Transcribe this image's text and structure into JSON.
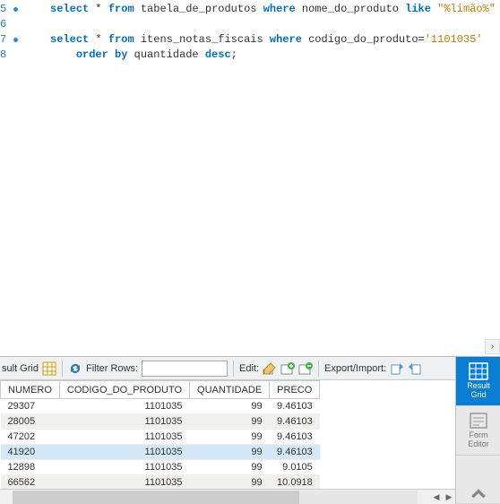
{
  "editor": {
    "lines": [
      {
        "num": "5",
        "dot": true,
        "indent": 1,
        "tokens": [
          {
            "t": "select",
            "c": "kw"
          },
          {
            "t": " * ",
            "c": "id"
          },
          {
            "t": "from",
            "c": "kw"
          },
          {
            "t": " tabela_de_produtos ",
            "c": "id"
          },
          {
            "t": "where",
            "c": "kw"
          },
          {
            "t": " nome_do_produto ",
            "c": "id"
          },
          {
            "t": "like",
            "c": "kw"
          },
          {
            "t": " ",
            "c": "id"
          },
          {
            "t": "\"%limão%\"",
            "c": "str"
          },
          {
            "t": " ;",
            "c": "punct"
          }
        ]
      },
      {
        "num": "6",
        "dot": false,
        "indent": 0,
        "tokens": []
      },
      {
        "num": "7",
        "dot": true,
        "indent": 1,
        "tokens": [
          {
            "t": "select",
            "c": "kw"
          },
          {
            "t": " * ",
            "c": "id"
          },
          {
            "t": "from",
            "c": "kw"
          },
          {
            "t": " itens_notas_fiscais ",
            "c": "id"
          },
          {
            "t": "where",
            "c": "kw"
          },
          {
            "t": " codigo_do_produto=",
            "c": "id"
          },
          {
            "t": "'1101035'",
            "c": "str2"
          }
        ]
      },
      {
        "num": "8",
        "dot": false,
        "indent": 2,
        "tokens": [
          {
            "t": "order by",
            "c": "kw"
          },
          {
            "t": " quantidade ",
            "c": "id"
          },
          {
            "t": "desc",
            "c": "kw"
          },
          {
            "t": ";",
            "c": "punct"
          }
        ]
      }
    ]
  },
  "toolbar": {
    "tab_label": "sult Grid",
    "filter_label": "Filter Rows:",
    "filter_value": "",
    "edit_label": "Edit:",
    "export_label": "Export/Import:"
  },
  "grid": {
    "columns": [
      "NUMERO",
      "CODIGO_DO_PRODUTO",
      "QUANTIDADE",
      "PRECO"
    ],
    "rows": [
      {
        "c": [
          "29307",
          "1101035",
          "99",
          "9.46103"
        ],
        "alt": false
      },
      {
        "c": [
          "28005",
          "1101035",
          "99",
          "9.46103"
        ],
        "alt": true
      },
      {
        "c": [
          "47202",
          "1101035",
          "99",
          "9.46103"
        ],
        "alt": false
      },
      {
        "c": [
          "41920",
          "1101035",
          "99",
          "9.46103"
        ],
        "alt": true,
        "sel": true
      },
      {
        "c": [
          "12898",
          "1101035",
          "99",
          "9.0105"
        ],
        "alt": false
      },
      {
        "c": [
          "66562",
          "1101035",
          "99",
          "10.0918"
        ],
        "alt": true
      }
    ]
  },
  "sidebar": {
    "result_grid": "Result\nGrid",
    "form_editor": "Form\nEditor"
  }
}
